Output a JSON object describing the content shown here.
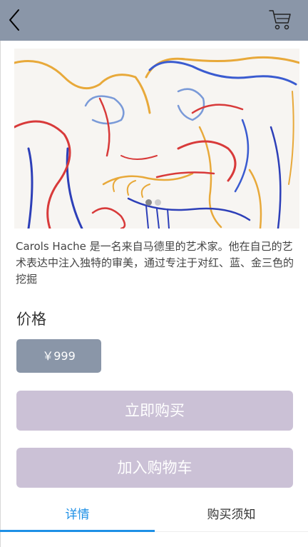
{
  "header": {
    "back_icon": "chevron-left-icon",
    "cart_icon": "shopping-cart-icon",
    "background_color": "#8a96a8"
  },
  "carousel": {
    "slide_count": 2,
    "active_index": 0,
    "dot_active_color": "#888888",
    "dot_inactive_color": "#cccccc"
  },
  "product": {
    "description": "Carols Hache 是一名来自马德里的艺术家。他在自己的艺术表达中注入独特的审美，通过专注于对红、蓝、金三色的挖掘",
    "price_label": "价格",
    "price": "￥999"
  },
  "actions": {
    "buy_now": "立即购买",
    "add_to_cart": "加入购物车"
  },
  "tabs": [
    {
      "label": "详情",
      "active": true
    },
    {
      "label": "购买须知",
      "active": false
    }
  ],
  "colors": {
    "accent": "#1e90e6",
    "button_fill": "#cbc1d6",
    "tab_text": "#333333"
  }
}
